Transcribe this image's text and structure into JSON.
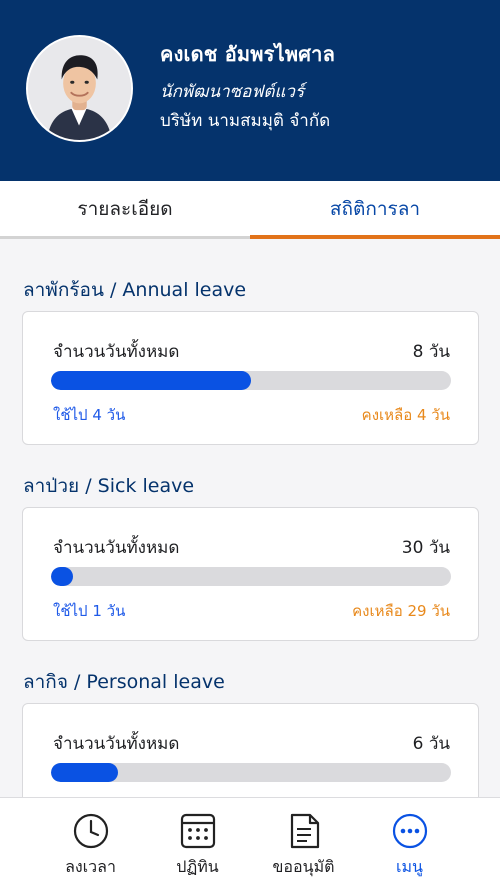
{
  "profile": {
    "name": "คงเดช อัมพรไพศาล",
    "role": "นักพัฒนาซอฟต์แวร์",
    "company": "บริษัท นามสมมุติ จำกัด"
  },
  "tabs": [
    {
      "label": "รายละเอียด",
      "active": false
    },
    {
      "label": "สถิติการลา",
      "active": true
    }
  ],
  "leave_sections": [
    {
      "title": "ลาพักร้อน / Annual leave",
      "total_label": "จำนวนวันทั้งหมด",
      "total_value": "8 วัน",
      "used_label": "ใช้ไป 4 วัน",
      "remaining_label": "คงเหลือ 4 วัน",
      "used_fraction": 0.5
    },
    {
      "title": "ลาป่วย / Sick leave",
      "total_label": "จำนวนวันทั้งหมด",
      "total_value": "30 วัน",
      "used_label": "ใช้ไป 1 วัน",
      "remaining_label": "คงเหลือ 29 วัน",
      "used_fraction": 0.0333
    },
    {
      "title": "ลากิจ / Personal leave",
      "total_label": "จำนวนวันทั้งหมด",
      "total_value": "6 วัน",
      "used_fraction": 0.1667
    }
  ],
  "bottom_nav": [
    {
      "label": "ลงเวลา",
      "icon": "clock-icon",
      "active": false
    },
    {
      "label": "ปฏิทิน",
      "icon": "calendar-icon",
      "active": false
    },
    {
      "label": "ขออนุมัติ",
      "icon": "document-icon",
      "active": false
    },
    {
      "label": "เมนู",
      "icon": "more-menu-icon",
      "active": true
    }
  ],
  "colors": {
    "header_bg": "#05336c",
    "accent_blue": "#0a52e3",
    "accent_orange": "#e2731a",
    "used_text": "#1f5ae8",
    "remaining_text": "#e8891c"
  }
}
